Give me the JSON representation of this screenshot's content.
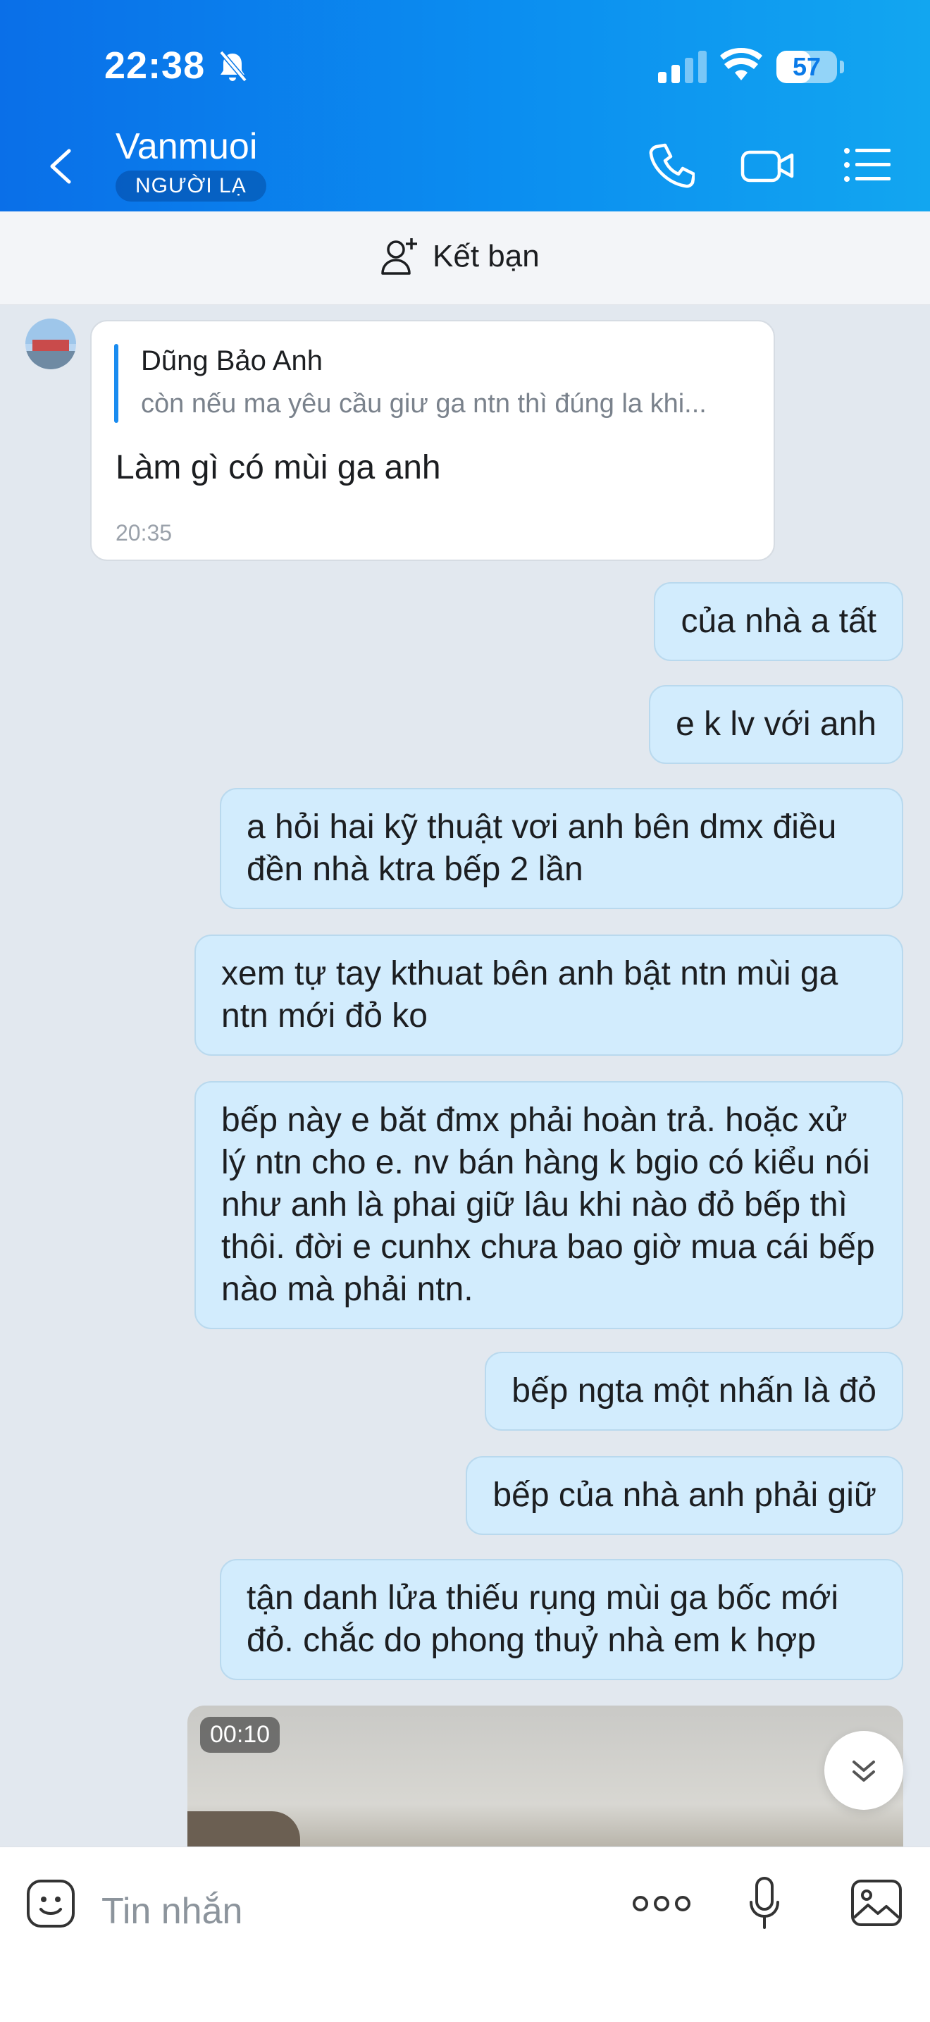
{
  "status": {
    "time": "22:38",
    "battery": "57",
    "battery_level": 0.57
  },
  "header": {
    "contact_name": "Vanmuoi",
    "badge": "NGƯỜI LẠ"
  },
  "friend_bar": {
    "label": "Kết bạn"
  },
  "incoming": {
    "quote_name": "Dũng Bảo Anh",
    "quote_text": "còn nếu ma yêu cầu giư ga ntn thì đúng la khi...",
    "text": "Làm gì có mùi ga anh",
    "time": "20:35"
  },
  "outgoing": [
    {
      "text": "của nhà a tất"
    },
    {
      "text": "e k lv với anh"
    },
    {
      "text": "a hỏi hai kỹ thuật vơi anh bên dmx điều đền nhà ktra bếp 2 lần"
    },
    {
      "text": "xem tự tay kthuat bên anh bật ntn mùi ga ntn mới đỏ ko"
    },
    {
      "text": "bếp này e băt đmx phải hoàn trả. hoặc xử lý ntn cho e. nv bán hàng k bgio có kiểu nói như anh là phai giữ lâu khi nào đỏ bếp thì thôi. đời e cunhx chưa bao giờ mua cái bếp nào mà phải ntn."
    },
    {
      "text": "bếp ngta một nhấn là đỏ"
    },
    {
      "text": "bếp của nhà anh phải giữ"
    },
    {
      "text": "tận danh lửa thiếu rụng mùi ga bốc mới đỏ. chắc do phong thuỷ nhà em k hợp"
    }
  ],
  "video": {
    "duration": "00:10"
  },
  "composer": {
    "placeholder": "Tin nhắn"
  },
  "colors": {
    "header_start": "#0a6fe8",
    "header_end": "#12a6f0",
    "outgoing_bubble": "#d2ecfd",
    "chat_bg": "#e2e8ef"
  }
}
